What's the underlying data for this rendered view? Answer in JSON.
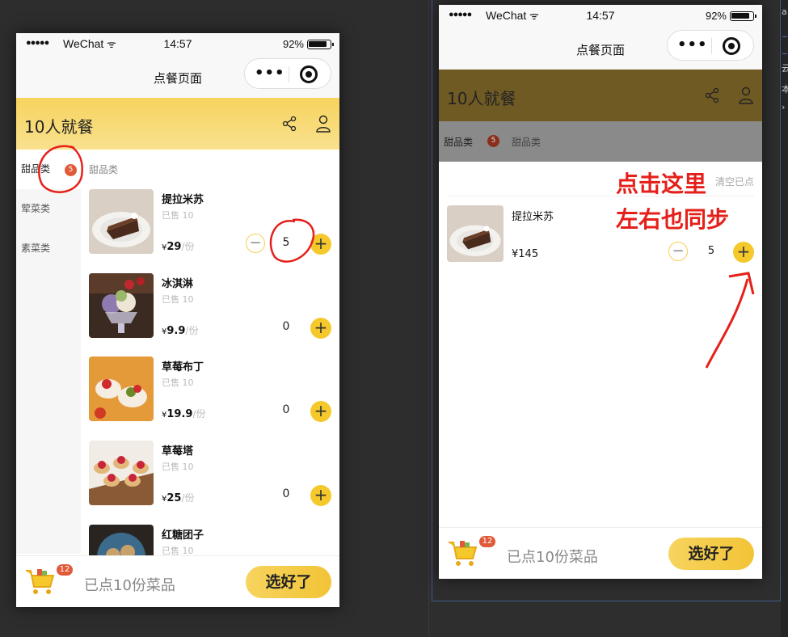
{
  "status": {
    "signal": "●●●●●",
    "carrier": "WeChat",
    "wifi": "ᯤ",
    "time": "14:57",
    "battery": "92%"
  },
  "navbar": {
    "title": "点餐页面",
    "menu_dots": "•••"
  },
  "header": {
    "title": "10人就餐"
  },
  "sidebar": {
    "items": [
      {
        "label": "甜品类",
        "badge": "5"
      },
      {
        "label": "荤菜类"
      },
      {
        "label": "素菜类"
      }
    ]
  },
  "category_label": "甜品类",
  "menu": {
    "currency": "¥",
    "unit": "/份",
    "sold_label": "已售 10",
    "items": [
      {
        "name": "提拉米苏",
        "price": "29",
        "qty": "5"
      },
      {
        "name": "冰淇淋",
        "price": "9.9",
        "qty": "0"
      },
      {
        "name": "草莓布丁",
        "price": "19.9",
        "qty": "0"
      },
      {
        "name": "草莓塔",
        "price": "25",
        "qty": "0"
      },
      {
        "name": "红糖团子",
        "price": "",
        "qty": ""
      }
    ]
  },
  "bottombar": {
    "cart_badge": "12",
    "summary": "已点10份菜品",
    "submit": "选好了"
  },
  "popup": {
    "clear_label": "清空已点",
    "item": {
      "name": "提拉米苏",
      "price": "¥145",
      "qty": "5"
    }
  },
  "annotations": {
    "line1": "点击这里",
    "line2": "左右也同步"
  },
  "colors": {
    "accent": "#f5c92b",
    "header": "#f7d45e",
    "badge": "#e05a3a",
    "annotation": "#e5201a"
  }
}
